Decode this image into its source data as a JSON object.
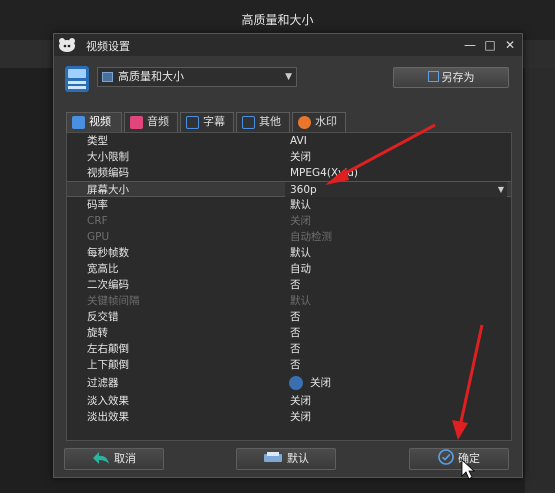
{
  "app": {
    "window_title": "高质量和大小"
  },
  "dialog": {
    "title": "视频设置",
    "preset": {
      "selected": "高质量和大小"
    },
    "save_as_label": "另存为",
    "tabs": [
      {
        "label": "视频",
        "icon": "film-icon",
        "color": "#4a90e2"
      },
      {
        "label": "音频",
        "icon": "music-icon",
        "color": "#e0467c"
      },
      {
        "label": "字幕",
        "icon": "subtitle-icon",
        "color": "#4a90e2"
      },
      {
        "label": "其他",
        "icon": "other-icon",
        "color": "#4a90e2"
      },
      {
        "label": "水印",
        "icon": "watermark-icon",
        "color": "#e8762c"
      }
    ],
    "properties": [
      {
        "key": "类型",
        "value": "AVI"
      },
      {
        "key": "大小限制",
        "value": "关闭"
      },
      {
        "key": "视频编码",
        "value": "MPEG4(Xvid)"
      },
      {
        "key": "屏幕大小",
        "value": "360p"
      },
      {
        "key": "码率",
        "value": "默认"
      },
      {
        "key": "CRF",
        "value": "关闭"
      },
      {
        "key": "GPU",
        "value": "自动检测"
      },
      {
        "key": "每秒帧数",
        "value": "默认"
      },
      {
        "key": "宽高比",
        "value": "自动"
      },
      {
        "key": "二次编码",
        "value": "否"
      },
      {
        "key": "关键帧间隔",
        "value": "默认"
      },
      {
        "key": "反交错",
        "value": "否"
      },
      {
        "key": "旋转",
        "value": "否"
      },
      {
        "key": "左右颠倒",
        "value": "否"
      },
      {
        "key": "上下颠倒",
        "value": "否"
      },
      {
        "key": "过滤器",
        "value": "关闭"
      },
      {
        "key": "淡入效果",
        "value": "关闭"
      },
      {
        "key": "淡出效果",
        "value": "关闭"
      }
    ],
    "buttons": {
      "cancel": "取消",
      "default": "默认",
      "ok": "确定"
    }
  },
  "colors": {
    "annotation_arrow": "#e02020",
    "accent": "#4a90e2"
  }
}
